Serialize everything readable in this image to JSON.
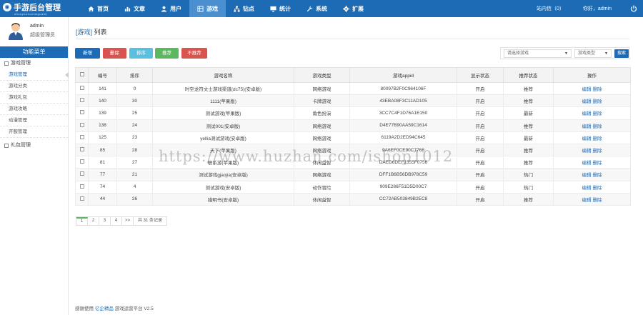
{
  "app": {
    "logo_title": "手游后台管理",
    "logo_sub": "shouyouhoutaiguanli"
  },
  "nav": [
    {
      "label": "首页",
      "icon": "home-icon"
    },
    {
      "label": "文章",
      "icon": "chart-icon"
    },
    {
      "label": "用户",
      "icon": "user-icon"
    },
    {
      "label": "游戏",
      "icon": "grid-icon",
      "active": true
    },
    {
      "label": "钻点",
      "icon": "sitemap-icon"
    },
    {
      "label": "统计",
      "icon": "monitor-icon"
    },
    {
      "label": "系统",
      "icon": "wrench-icon"
    },
    {
      "label": "扩展",
      "icon": "gear-icon"
    }
  ],
  "topright": {
    "messages": "站内信（0）",
    "greeting": "你好，admin"
  },
  "user": {
    "name": "admin",
    "role": "超级管理员"
  },
  "sidebar": {
    "title": "功能菜单",
    "groups": [
      {
        "label": "游戏管理",
        "items": [
          "游戏管理",
          "游戏分类",
          "游戏礼包",
          "游戏攻略",
          "动漫管理",
          "开服管理"
        ]
      },
      {
        "label": "礼包管理",
        "items": []
      }
    ]
  },
  "page": {
    "title_main": "[游戏]",
    "title_sub": "列表"
  },
  "toolbar": {
    "add": "新增",
    "delete": "删除",
    "sort": "排序",
    "recommend": "推荐",
    "unrecommend": "不推荐"
  },
  "filter": {
    "game_placeholder": "请选择游戏",
    "type_placeholder": "游戏类型",
    "search": "搜索"
  },
  "table": {
    "headers": [
      "编号",
      "排序",
      "游戏名称",
      "游戏类型",
      "游戏appid",
      "显示状态",
      "推荐状态",
      "操作"
    ],
    "rows": [
      {
        "id": "141",
        "sort": "0",
        "name": "时空龙符文士游戏渠道(dc75)(安卓版)",
        "type": "网络游戏",
        "appid": "80097B2F0C964106F",
        "show": "开启",
        "rec": "推荐",
        "ops": [
          "编辑",
          "删除"
        ]
      },
      {
        "id": "140",
        "sort": "30",
        "name": "1111(苹果版)",
        "type": "卡牌游戏",
        "appid": "43EBA08F3C11AD105",
        "show": "开启",
        "rec": "推荐",
        "ops": [
          "编辑",
          "删除"
        ]
      },
      {
        "id": "139",
        "sort": "25",
        "name": "测试游戏(苹果版)",
        "type": "角色扮演",
        "appid": "3CC7C4F1D76A1E150",
        "show": "开启",
        "rec": "最新",
        "ops": [
          "编辑",
          "删除"
        ]
      },
      {
        "id": "138",
        "sort": "24",
        "name": "测试001(安卓版)",
        "type": "网络游戏",
        "appid": "D4E77B90AA59C1614",
        "show": "开启",
        "rec": "推荐",
        "ops": [
          "编辑",
          "删除"
        ]
      },
      {
        "id": "125",
        "sort": "23",
        "name": "yellia测试游戏(安卓版)",
        "type": "网络游戏",
        "appid": "6119A2D2ED94C645",
        "show": "开启",
        "rec": "最新",
        "ops": [
          "编辑",
          "删除"
        ]
      },
      {
        "id": "85",
        "sort": "28",
        "name": "天下(苹果版)",
        "type": "网络游戏",
        "appid": "9A6EF0CE90C7768",
        "show": "开启",
        "rec": "推荐",
        "ops": [
          "编辑",
          "删除"
        ]
      },
      {
        "id": "81",
        "sort": "27",
        "name": "联系游(苹果版)",
        "type": "休闲益智",
        "appid": "DAED6DEF1355F0756",
        "show": "开启",
        "rec": "推荐",
        "ops": [
          "编辑",
          "删除"
        ]
      },
      {
        "id": "77",
        "sort": "21",
        "name": "测试游戏gjaojia(安卓版)",
        "type": "网络游戏",
        "appid": "DFF1B6B56DB978C59",
        "show": "开启",
        "rec": "热门",
        "ops": [
          "编辑",
          "删除"
        ]
      },
      {
        "id": "74",
        "sort": "4",
        "name": "测试游戏(安卓版)",
        "type": "动作冒险",
        "appid": "909E286F51D5D00C7",
        "show": "开启",
        "rec": "热门",
        "ops": [
          "编辑",
          "删除"
        ]
      },
      {
        "id": "44",
        "sort": "26",
        "name": "猎明书(安卓版)",
        "type": "休闲益智",
        "appid": "CC72AB503849B2EC8",
        "show": "开启",
        "rec": "推荐",
        "ops": [
          "编辑",
          "删除"
        ]
      }
    ]
  },
  "pager": {
    "pages": [
      "1",
      "2",
      "3",
      "4",
      ">>"
    ],
    "total": "共 31 条记录"
  },
  "footer": {
    "prefix": "感谢使用",
    "brand": "亿企精品",
    "suffix": "游戏运营平台 V2.5"
  },
  "watermark": "https://www.huzhan.com/ishop1012",
  "colors": {
    "primary": "#1c6bb4",
    "danger": "#d9534f",
    "info": "#5bc0de",
    "success": "#5cb85c"
  }
}
